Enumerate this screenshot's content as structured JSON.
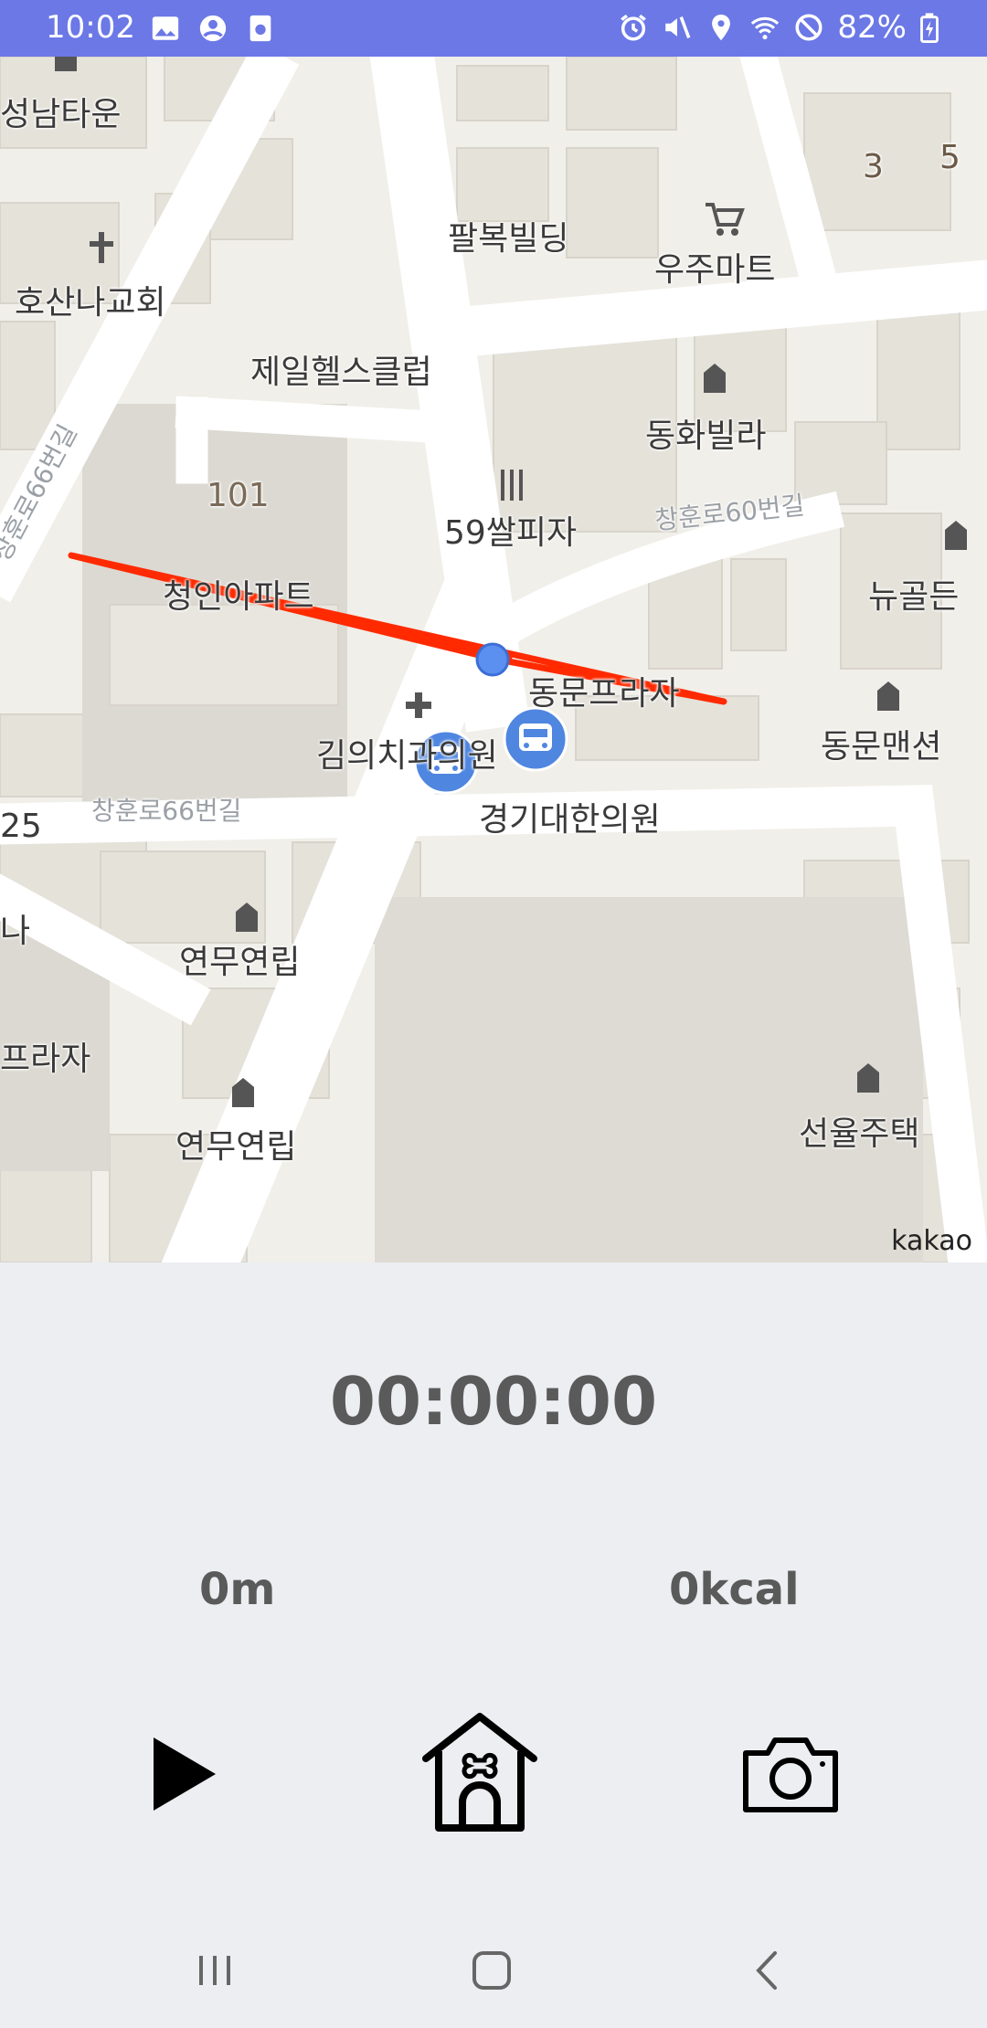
{
  "status_bar": {
    "time": "10:02",
    "battery": "82%",
    "icons_left": [
      "image-icon",
      "account-icon",
      "screen-record-icon"
    ],
    "icons_right": [
      "alarm-icon",
      "mute-icon",
      "location-icon",
      "wifi-icon",
      "block-icon",
      "battery-icon"
    ],
    "color": "#6b78e6"
  },
  "map": {
    "attribution": "kakao",
    "labels": {
      "seongnam_town": "성남타운",
      "hosanna_church": "호산나교회",
      "palbok_building": "팔복빌딩",
      "uju_mart": "우주마트",
      "jeil_health": "제일헬스클럽",
      "donghwa_villa": "동화빌라",
      "pizza": "59쌀피자",
      "apt_101": "101",
      "apt_name": "청인아파트",
      "newgol": "뉴골든",
      "dongmun_plaza": "동문프라자",
      "dongmun_mansion": "동문맨션",
      "kim_clinic": "김의치과의원",
      "gyeonggi_clinic": "경기대한의원",
      "yeonmu_1": "연무연립",
      "yeonmu_2": "연무연립",
      "plaza_left": "프라자",
      "seonyul": "선율주택",
      "num_3": "3",
      "num_5": "5",
      "num_25": "25",
      "na": "나"
    },
    "road_labels": {
      "changhun_60": "창훈로60번길",
      "changhun_66_vertical": "창훈로66번길",
      "changhun_66": "창훈로66번길"
    },
    "route_color": "#ff2a00",
    "bus_stop_color": "#4f86e0"
  },
  "panel": {
    "timer": "00:00:00",
    "distance": "0m",
    "calories": "0kcal"
  },
  "controls": {
    "play": "play-icon",
    "home": "dog-house-icon",
    "camera": "camera-icon"
  },
  "nav_bar": {
    "recent": "recent-apps-icon",
    "home": "home-icon",
    "back": "back-icon"
  }
}
